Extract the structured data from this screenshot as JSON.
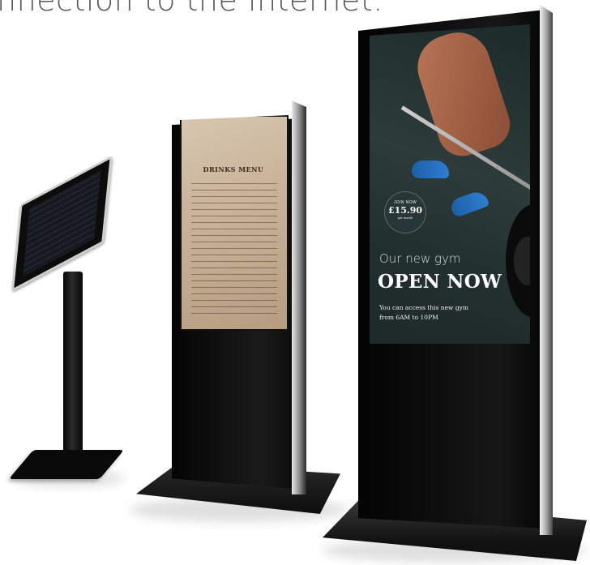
{
  "caption": "nnection to the internet.",
  "menu_screen": {
    "title": "DRINKS MENU"
  },
  "gym_screen": {
    "price_pre": "JOIN NOW",
    "price": "£15.90",
    "price_post": "per month",
    "subheading": "Our new gym",
    "headline": "OPEN NOW",
    "body_line1": "You can access this new gym",
    "body_line2": "from 6AM to 10PM"
  },
  "colors": {
    "background": "#ffffff",
    "kiosk_black": "#0a0a0a",
    "frame_silver": "#cfcfcf"
  }
}
